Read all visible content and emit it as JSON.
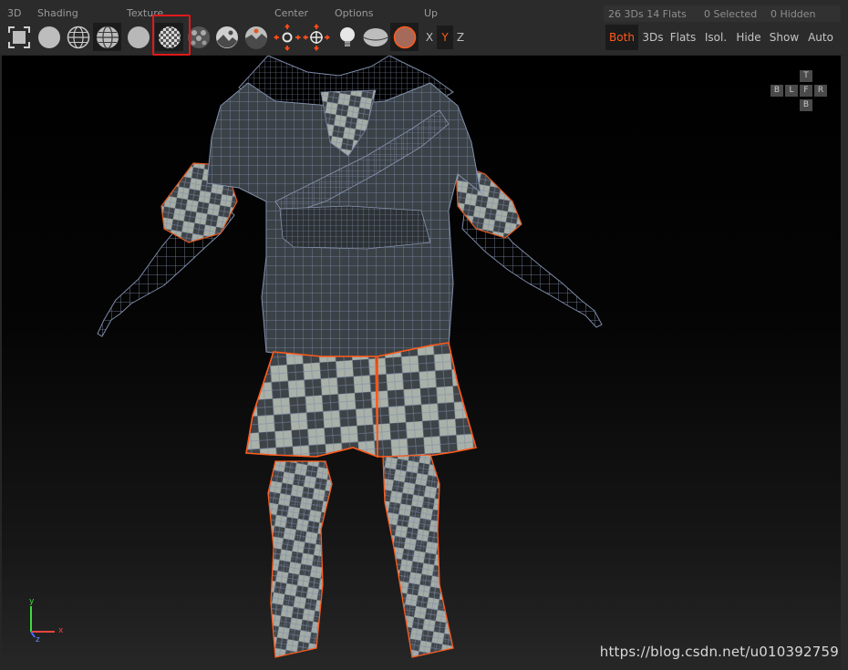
{
  "toolbar": {
    "groups": {
      "three_d": "3D",
      "shading": "Shading",
      "texture": "Texture",
      "center": "Center",
      "options": "Options",
      "up": "Up"
    },
    "stats": {
      "counts": "26 3Ds 14 Flats",
      "selected": "0 Selected",
      "hidden": "0 Hidden"
    },
    "buttons": {
      "frame": "frame-icon",
      "shading_flat": "sphere-flat-icon",
      "shading_wire": "sphere-wireframe-icon",
      "shading_wire_solid": "sphere-wire-solid-icon",
      "texture_none": "sphere-plain-icon",
      "texture_checker": "checker-sphere-icon",
      "texture_dots": "dotted-sphere-icon",
      "texture_image": "image-sphere-icon",
      "texture_uv": "uv-sphere-icon",
      "center_a": "center-cross-icon",
      "center_b": "center-target-icon",
      "option_light": "light-bulb-icon",
      "option_ellipse": "ellipse-icon",
      "option_orange": "orange-sphere-icon"
    },
    "up_axes": [
      "X",
      "Y",
      "Z"
    ],
    "up_active": "Y",
    "modes": [
      "Both",
      "3Ds",
      "Flats",
      "Isol.",
      "Hide",
      "Show",
      "Auto"
    ],
    "mode_active": "Both",
    "highlighted_button": "checker-sphere-icon",
    "accent_color": "#ff5a1a",
    "highlight_color": "#e0191b"
  },
  "viewport": {
    "navcube": {
      "top": "T",
      "left_b": "B",
      "left": "L",
      "front": "F",
      "right": "R",
      "bottom": "B"
    },
    "gizmo": {
      "y": "y",
      "x": "x",
      "z": "z"
    },
    "watermark": "https://blog.csdn.net/u010392759"
  }
}
